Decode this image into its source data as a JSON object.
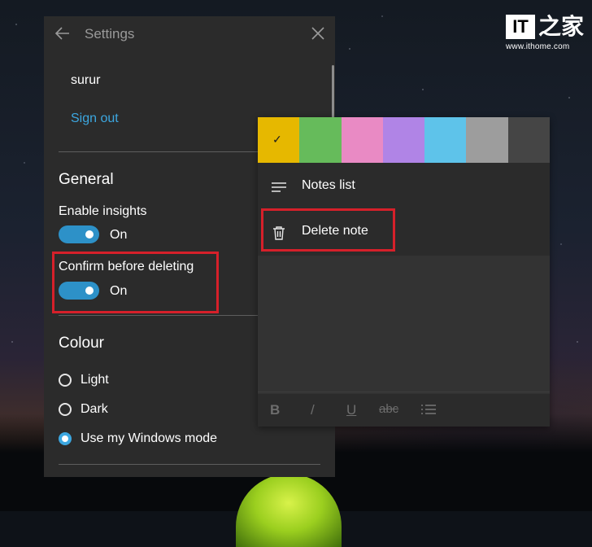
{
  "watermark": {
    "logo_text": "IT",
    "logo_char": "之家",
    "url": "www.ithome.com"
  },
  "settings": {
    "title": "Settings",
    "user_name": "surur",
    "sign_out": "Sign out",
    "general": {
      "heading": "General",
      "enable_insights": {
        "label": "Enable insights",
        "state": "On"
      },
      "confirm_delete": {
        "label": "Confirm before deleting",
        "state": "On"
      }
    },
    "colour": {
      "heading": "Colour",
      "options": [
        {
          "label": "Light",
          "selected": false
        },
        {
          "label": "Dark",
          "selected": false
        },
        {
          "label": "Use my Windows mode",
          "selected": true
        }
      ]
    },
    "accent_color": "#2d91c8",
    "link_color": "#3ca7e0"
  },
  "menu": {
    "swatches": [
      "#e6b800",
      "#66bb5b",
      "#e98ac4",
      "#b084e6",
      "#5ec3ea",
      "#9d9d9d",
      "#454545"
    ],
    "selected_swatch": 0,
    "items": [
      {
        "label": "Notes list",
        "icon": "list-icon"
      },
      {
        "label": "Delete note",
        "icon": "trash-icon"
      }
    ],
    "format": {
      "bold": "B",
      "italic": "/",
      "underline": "U",
      "strike": "abc",
      "list_icon": "bullet-list-icon"
    }
  },
  "highlight_color": "#d6202a"
}
